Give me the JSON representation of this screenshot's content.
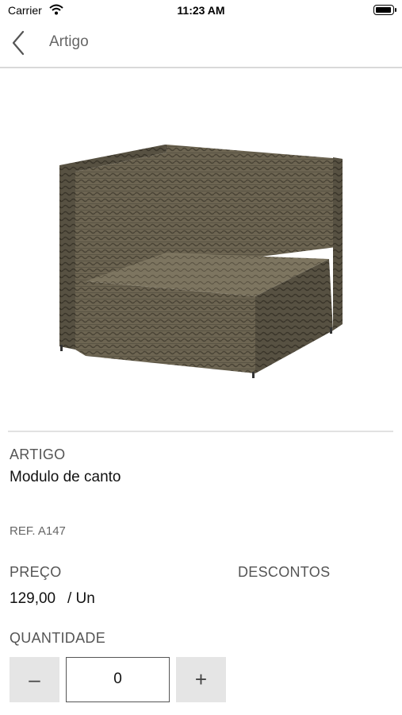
{
  "status_bar": {
    "carrier": "Carrier",
    "time": "11:23 AM",
    "battery_level": 1.0
  },
  "nav": {
    "title": "Artigo",
    "back_icon": "chevron-left-icon"
  },
  "product": {
    "image": "wicker-corner-sofa-module",
    "artigo_label": "ARTIGO",
    "name": "Modulo de canto",
    "ref": "REF. A147",
    "preco_label": "PREÇO",
    "descontos_label": "DESCONTOS",
    "price": "129,00",
    "unit": "/ Un",
    "quantidade_label": "QUANTIDADE"
  },
  "quantity": {
    "minus_label": "–",
    "value": "0",
    "plus_label": "+"
  }
}
